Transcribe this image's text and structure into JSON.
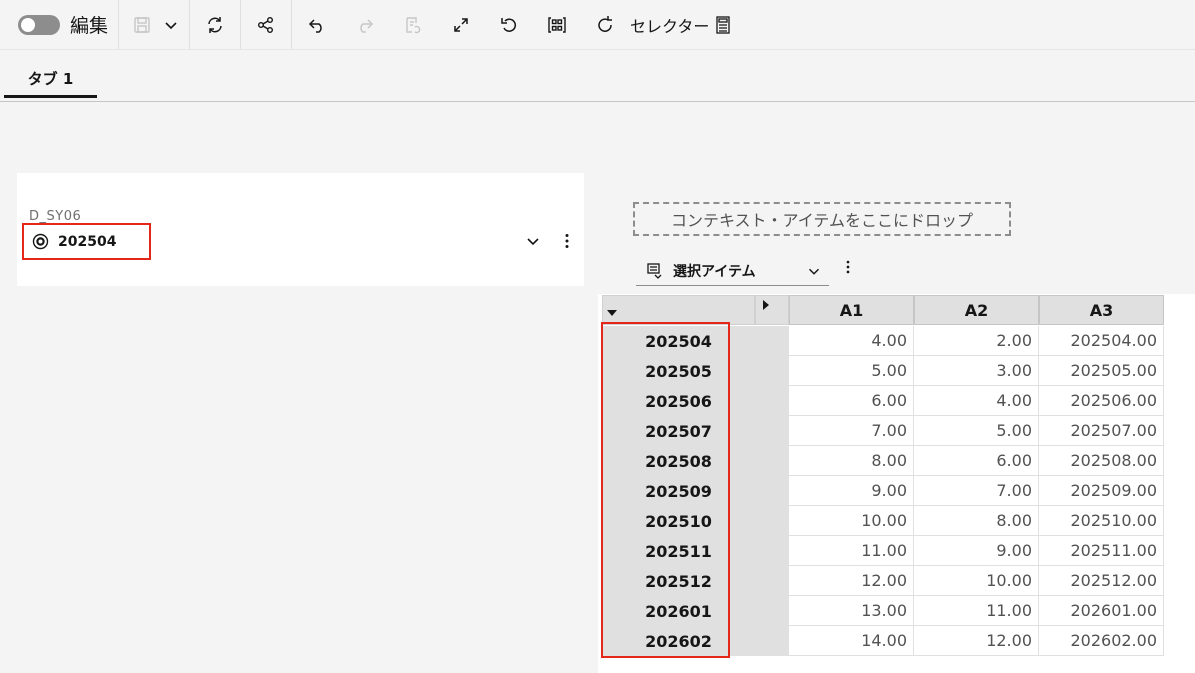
{
  "toolbar": {
    "edit_label": "編集",
    "selector_label": "セレクター"
  },
  "tabs": [
    {
      "label": "タブ 1"
    }
  ],
  "selector_card": {
    "caption": "D_SY06",
    "value": "202504"
  },
  "table_card": {
    "drop_zone_label": "コンテキスト・アイテムをここにドロップ",
    "selection_dropdown": "選択アイテム",
    "columns": [
      "A1",
      "A2",
      "A3"
    ],
    "rows": [
      {
        "label": "202504",
        "values": [
          "4.00",
          "2.00",
          "202504.00"
        ]
      },
      {
        "label": "202505",
        "values": [
          "5.00",
          "3.00",
          "202505.00"
        ]
      },
      {
        "label": "202506",
        "values": [
          "6.00",
          "4.00",
          "202506.00"
        ]
      },
      {
        "label": "202507",
        "values": [
          "7.00",
          "5.00",
          "202507.00"
        ]
      },
      {
        "label": "202508",
        "values": [
          "8.00",
          "6.00",
          "202508.00"
        ]
      },
      {
        "label": "202509",
        "values": [
          "9.00",
          "7.00",
          "202509.00"
        ]
      },
      {
        "label": "202510",
        "values": [
          "10.00",
          "8.00",
          "202510.00"
        ]
      },
      {
        "label": "202511",
        "values": [
          "11.00",
          "9.00",
          "202511.00"
        ]
      },
      {
        "label": "202512",
        "values": [
          "12.00",
          "10.00",
          "202512.00"
        ]
      },
      {
        "label": "202601",
        "values": [
          "13.00",
          "11.00",
          "202601.00"
        ]
      },
      {
        "label": "202602",
        "values": [
          "14.00",
          "12.00",
          "202602.00"
        ]
      }
    ]
  },
  "colors": {
    "highlight": "#e4261b",
    "header_bg": "#e0e0e0"
  }
}
